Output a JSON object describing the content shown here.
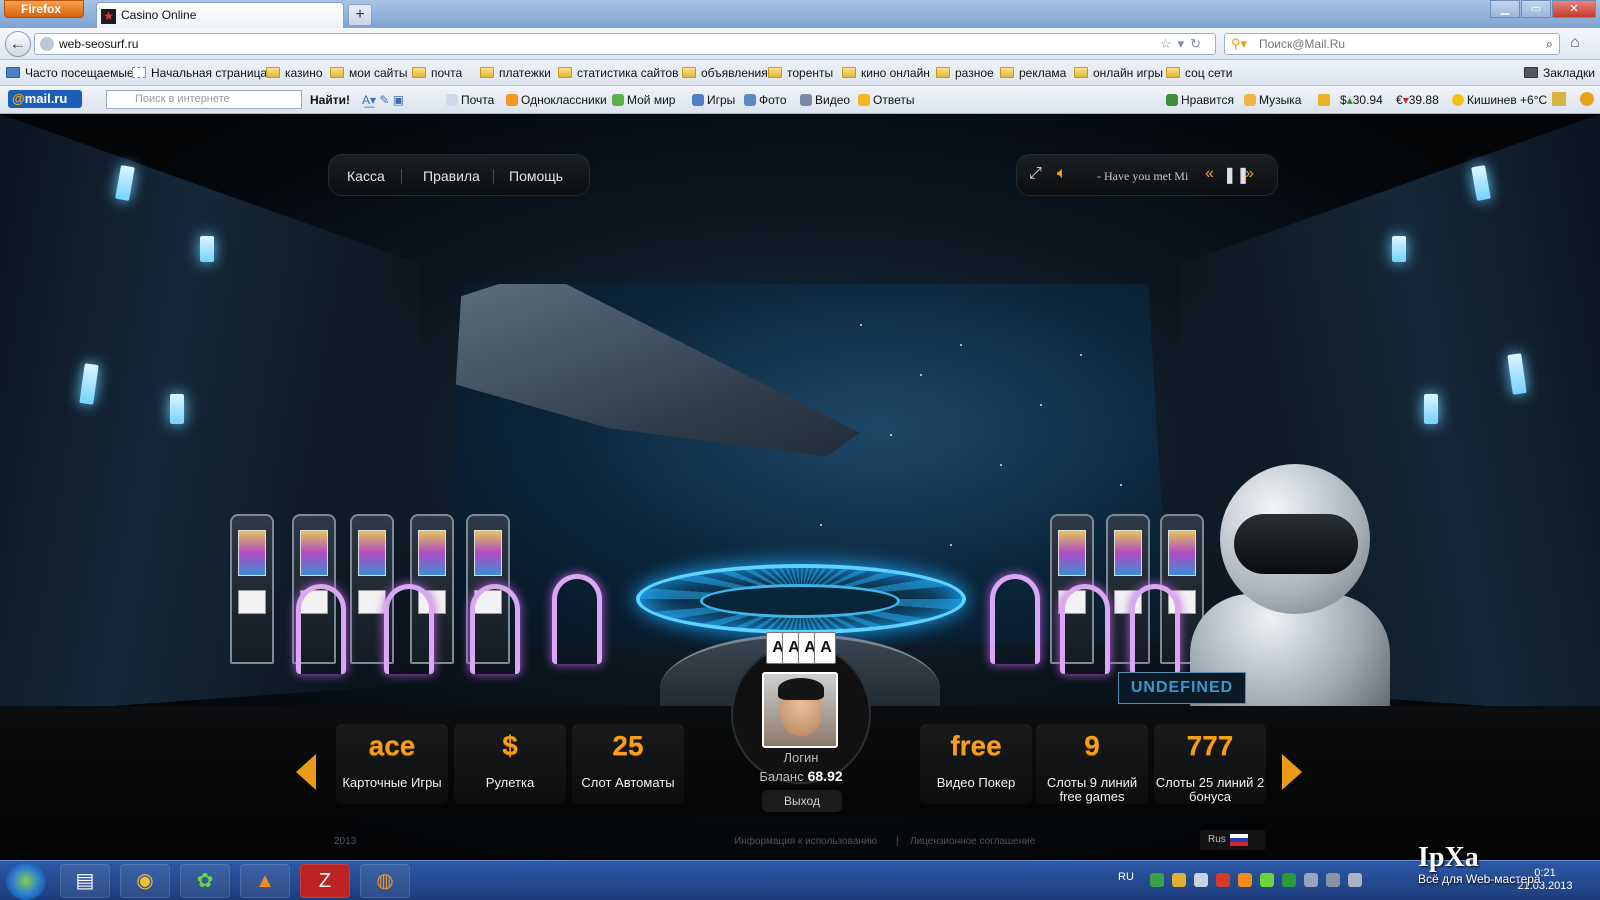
{
  "browser": {
    "menu_button": "Firefox",
    "tab_title": "Casino Online",
    "new_tab": "+",
    "url": "web-seosurf.ru",
    "search_placeholder": "Поиск@Mail.Ru",
    "bookmarks": [
      "Часто посещаемые",
      "Начальная страница",
      "казино",
      "мои сайты",
      "почта",
      "платежки",
      "статистика сайтов",
      "объявления",
      "торенты",
      "кино онлайн",
      "разное",
      "реклама",
      "онлайн игры",
      "соц сети"
    ],
    "bookmarks_menu": "Закладки"
  },
  "mail_toolbar": {
    "logo": "@mail.ru",
    "search_placeholder": "Поиск в интернете",
    "find_button": "Найти!",
    "links": [
      "Почта",
      "Одноклассники",
      "Мой мир",
      "Игры",
      "Фото",
      "Видео",
      "Ответы"
    ],
    "right_items": [
      "Нравится",
      "Музыка"
    ],
    "usd": "30.94",
    "eur": "39.88",
    "weather": "Кишинев +6°C",
    "colors": {
      "logo_bg": "#1c5fb7",
      "logo_accent": "#ffa700"
    }
  },
  "casino": {
    "menu": [
      "Касса",
      "Правила",
      "Помощь"
    ],
    "player": {
      "track": "- Have you met Mi",
      "icons": [
        "fullscreen-icon",
        "volume-icon",
        "prev-icon",
        "pause-icon",
        "next-icon"
      ]
    },
    "undefined_label": "UNDEFINED",
    "games_left": [
      {
        "icon_text": "ace",
        "label": "Карточные Игры"
      },
      {
        "icon_text": "$",
        "label": "Рулетка"
      },
      {
        "icon_text": "25",
        "label": "Слот Автоматы"
      }
    ],
    "games_right": [
      {
        "icon_text": "free",
        "label": "Видео Покер"
      },
      {
        "icon_text": "9",
        "label": "Слоты 9 линий free games"
      },
      {
        "icon_text": "777",
        "label": "Слоты 25 линий 2 бонуса"
      }
    ],
    "user": {
      "login": "Логин",
      "balance_label": "Баланс",
      "balance": "68.92",
      "logout": "Выход"
    },
    "footer": {
      "year": "2013",
      "info": "Информация к использованию",
      "license": "Лицензионное соглашение",
      "separator": "|",
      "lang": "Rus"
    },
    "colors": {
      "accent": "#f6a019",
      "holo": "#5fd3ff"
    }
  },
  "taskbar": {
    "lang": "RU",
    "time": "0:21",
    "date": "21.03.2013"
  },
  "watermark": {
    "logo": "IpXa",
    "caption": "Всё для Web-мастера"
  }
}
